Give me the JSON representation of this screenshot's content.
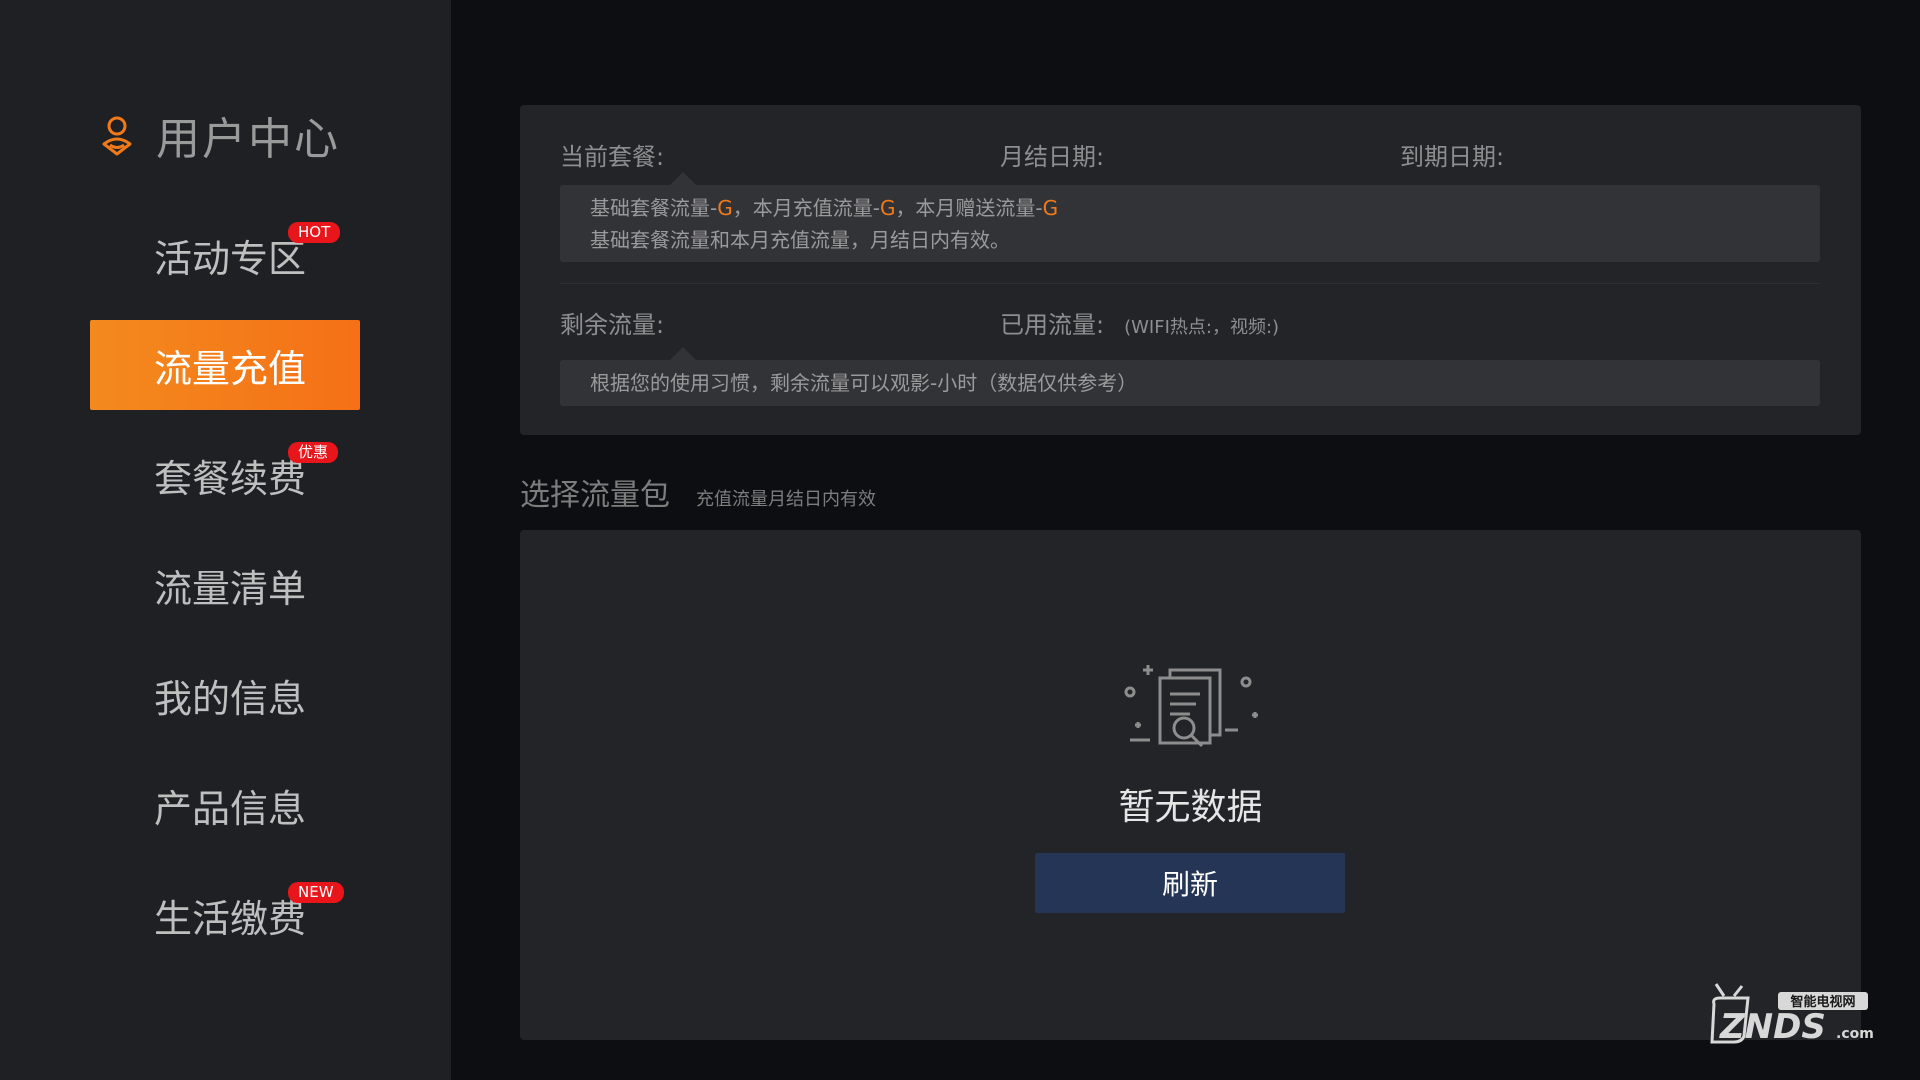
{
  "sidebar": {
    "title": "用户中心",
    "items": [
      {
        "label": "活动专区",
        "badge": "HOT"
      },
      {
        "label": "流量充值",
        "badge": ""
      },
      {
        "label": "套餐续费",
        "badge": "优惠"
      },
      {
        "label": "流量清单",
        "badge": ""
      },
      {
        "label": "我的信息",
        "badge": ""
      },
      {
        "label": "产品信息",
        "badge": ""
      },
      {
        "label": "生活缴费",
        "badge": "NEW"
      }
    ],
    "active_index": 1
  },
  "summary": {
    "current_plan_label": "当前套餐:",
    "settle_date_label": "月结日期:",
    "expire_date_label": "到期日期:",
    "box1": {
      "line1": {
        "p1": "基础套餐流量-",
        "g1": "G",
        "p2": "，本月充值流量-",
        "g2": "G",
        "p3": "，本月赠送流量-",
        "g3": "G"
      },
      "line2": "基础套餐流量和本月充值流量，月结日内有效。"
    },
    "remaining_label": "剩余流量:",
    "used_label": "已用流量:",
    "used_note": "(WIFI热点:，视频:)",
    "box2_text": "根据您的使用习惯，剩余流量可以观影-小时（数据仅供参考）"
  },
  "packages": {
    "title": "选择流量包",
    "subtitle": "充值流量月结日内有效",
    "empty_text": "暂无数据",
    "refresh_label": "刷新"
  },
  "watermark": {
    "brand": "ZNDS",
    "suffix": ".com",
    "tag": "智能电视网"
  },
  "colors": {
    "accent": "#f07a1a",
    "active_menu": "#f38a1e",
    "badge": "#e8161b",
    "button": "#253556"
  }
}
